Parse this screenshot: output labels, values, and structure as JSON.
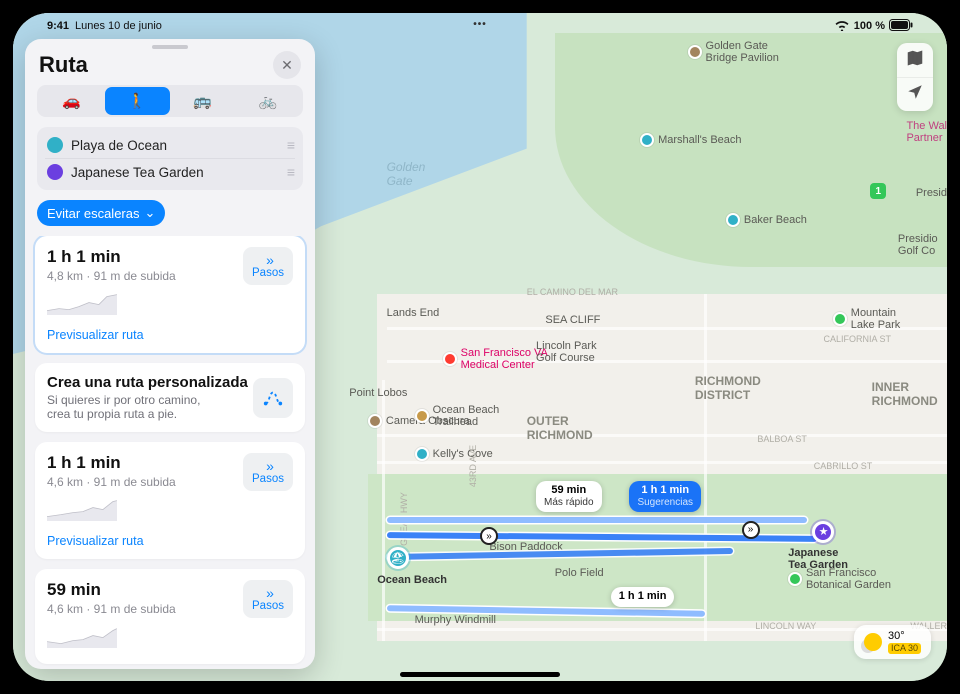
{
  "status": {
    "time": "9:41",
    "date": "Lunes 10 de junio",
    "wifi_icon": "wifi",
    "battery_text": "100 %"
  },
  "map_controls": {
    "modes_icon": "map-modes",
    "locate_icon": "location-arrow"
  },
  "weather": {
    "temp": "30°",
    "aqi_label": "ICA 30"
  },
  "panel": {
    "title": "Ruta",
    "modes": {
      "drive": "car",
      "walk": "walk",
      "transit": "transit",
      "cycle": "bike"
    },
    "from_label": "Playa de Ocean",
    "to_label": "Japanese Tea Garden",
    "options_chip": "Evitar escaleras",
    "custom": {
      "title": "Crea una ruta personalizada",
      "desc": "Si quieres ir por otro camino, crea tu propia ruta a pie."
    },
    "steps_label": "Pasos",
    "preview_label": "Previsualizar ruta",
    "routes": [
      {
        "time": "1 h 1 min",
        "sub": "4,8 km · 91 m de subida"
      },
      {
        "time": "1 h 1 min",
        "sub": "4,6 km · 91 m de subida"
      },
      {
        "time": "59 min",
        "sub": "4,6 km · 91 m de subida"
      }
    ]
  },
  "labels_on_map": {
    "ocean_name": "Golden\nGate",
    "callout_fast_time": "59 min",
    "callout_fast_sub": "Más rápido",
    "callout_main_time": "1 h 1 min",
    "callout_main_sub": "Sugerencias",
    "callout_alt_time": "1 h 1 min",
    "start_name": "Ocean Beach",
    "end_name": "Japanese\nTea Garden",
    "poi": {
      "ggbp": "Golden Gate\nBridge Pavilion",
      "marshall": "Marshall's Beach",
      "baker": "Baker Beach",
      "landsend": "Lands End",
      "ptlobos": "Point Lobos",
      "seacliff": "SEA CLIFF",
      "camera": "Camera Obscura",
      "kellys": "Kelly's Cove",
      "sfva": "San Francisco VA\nMedical Center",
      "lincoln": "Lincoln Park\nGolf Course",
      "elcamino": "EL CAMINO DEL MAR",
      "richmond": "RICHMOND\nDISTRICT",
      "outerrich": "OUTER\nRICHMOND",
      "innerrich": "INNER\nRICHMOND",
      "california": "CALIFORNIA ST",
      "balboa": "BALBOA ST",
      "cabrillo": "CABRILLO ST",
      "mtlake": "Mountain\nLake Park",
      "presidio_golf": "Presidio\nGolf Co",
      "presidio": "Presid",
      "wp": "The Wal\nPartner",
      "obtrail": "Ocean Beach\nTrailhead",
      "bison": "Bison Paddock",
      "polo": "Polo Field",
      "murphy": "Murphy Windmill",
      "sfbot": "San Francisco\nBotanical Garden",
      "lincolnway": "LINCOLN WAY",
      "hwy1": "1",
      "greathwy": "GREAT HWY",
      "43rd": "43RD AVE",
      "waller": "WALLER"
    }
  }
}
